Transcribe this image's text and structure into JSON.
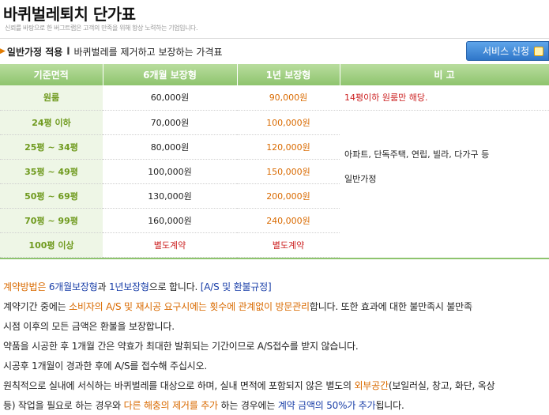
{
  "page": {
    "title": "바퀴벌레퇴치 단가표",
    "subtitle": "신뢰를 바탕으로 한 버그트랩은 고객의 만족을 위해 항상 노력하는 기업입니다."
  },
  "filter": {
    "strong": "일반가정 적용",
    "sep": "l",
    "desc": "바퀴벌레를 제거하고 보장하는 가격표"
  },
  "service_button": {
    "label": "서비스 신청"
  },
  "table": {
    "headers": [
      "기준면적",
      "6개월 보장형",
      "1년 보장형",
      "비 고"
    ],
    "rows": [
      {
        "area": "원룸",
        "m6": "60,000원",
        "y1": "90,000원"
      },
      {
        "area": "24평 이하",
        "m6": "70,000원",
        "y1": "100,000원"
      },
      {
        "area": "25평 ~ 34평",
        "m6": "80,000원",
        "y1": "120,000원"
      },
      {
        "area": "35평 ~ 49평",
        "m6": "100,000원",
        "y1": "150,000원"
      },
      {
        "area": "50평 ~ 69평",
        "m6": "130,000원",
        "y1": "200,000원"
      },
      {
        "area": "70평 ~ 99평",
        "m6": "160,000원",
        "y1": "240,000원"
      },
      {
        "area": "100평 이상",
        "m6": "별도계약",
        "y1": "별도계약"
      }
    ],
    "remark_oneroom": "14평이하 원룸만 해당.",
    "remark_types": "아파트, 단독주택, 연립, 빌라, 다가구 등",
    "remark_home": "일반가정"
  },
  "notes": {
    "l1a": "계약방법은",
    "l1b": "6개월보장형",
    "l1c": "과",
    "l1d": "1년보장형",
    "l1e": "으로 합니다.",
    "l1link": "[A/S 및 환불규정]",
    "l2a": "계약기간 중에는",
    "l2b": "소비자의 A/S 및 재시공 요구시에는 횟수에 관계없이 방문관리",
    "l2c": "합니다. 또한 효과에 대한 불만족시 불만족",
    "l3": "시점 이후의 모든 금액은 환불을 보장합니다.",
    "l4": "약품을 시공한 후 1개월 간은 약효가 최대한 발휘되는 기간이므로 A/S접수를 받지 않습니다.",
    "l5": "시공후 1개월이 경과한 후에 A/S를 접수해 주십시오.",
    "l6a": "원칙적으로 실내에 서식하는 바퀴벌레를 대상으로 하며, 실내 면적에 포함되지 않은 별도의",
    "l6b": "외부공간",
    "l6c": "(보일러실, 창고, 화단, 옥상",
    "l7a": "등) 작업을 필요로 하는 경우와",
    "l7b": "다른 해충의 제거를 추가",
    "l7c": "하는 경우에는",
    "l7d": "계약 금액의 50%가 추가",
    "l7e": "됩니다."
  },
  "colors": {
    "header_green": "#8ec46e",
    "area_green": "#6f9a1e",
    "price_orange": "#d96a00",
    "alert_red": "#cc2222",
    "link_blue": "#1a3fa8",
    "button_blue": "#2f76c9"
  }
}
